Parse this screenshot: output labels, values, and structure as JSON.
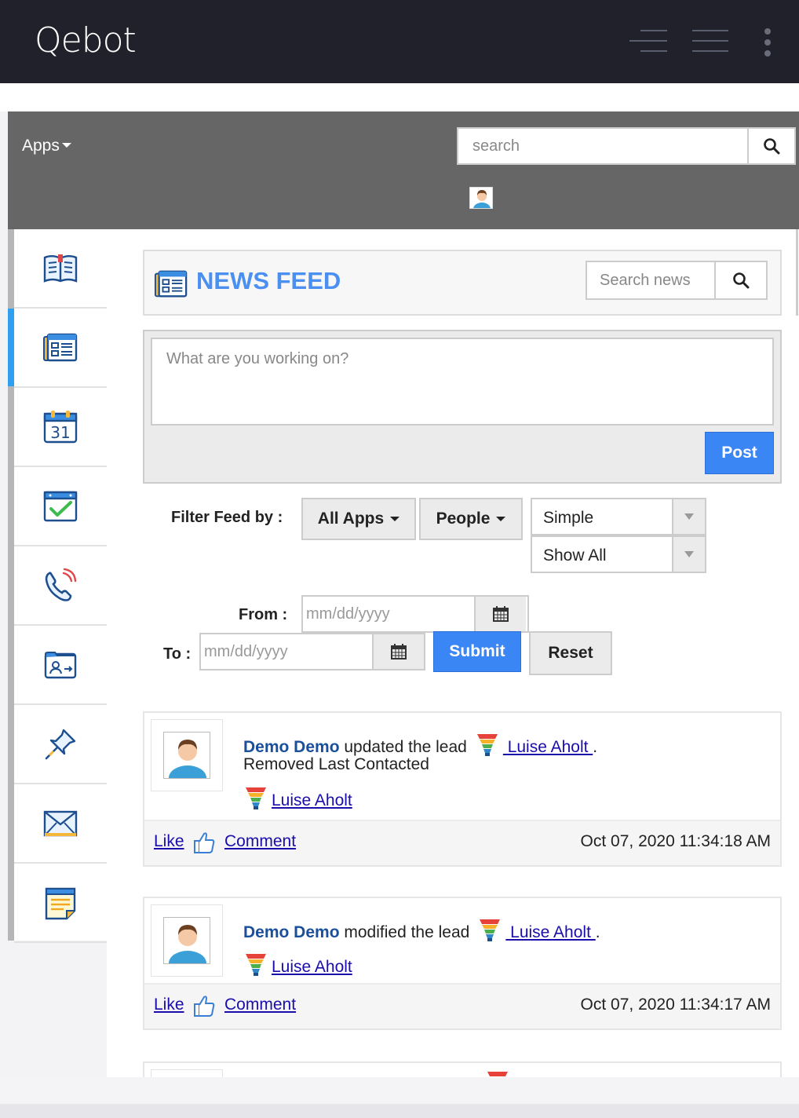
{
  "app": {
    "brand": "Qebot"
  },
  "appbar": {
    "apps_label": "Apps",
    "search_placeholder": "search"
  },
  "sidebar": {
    "items": [
      {
        "name": "sidebar-item-guide",
        "icon": "book-icon"
      },
      {
        "name": "sidebar-item-newsfeed",
        "icon": "newsfeed-icon",
        "active": true
      },
      {
        "name": "sidebar-item-calendar",
        "icon": "calendar-icon",
        "calendar_day": "31"
      },
      {
        "name": "sidebar-item-tasks",
        "icon": "task-check-icon"
      },
      {
        "name": "sidebar-item-calls",
        "icon": "phone-icon"
      },
      {
        "name": "sidebar-item-contacts",
        "icon": "contact-card-icon"
      },
      {
        "name": "sidebar-item-pins",
        "icon": "pushpin-icon"
      },
      {
        "name": "sidebar-item-mail",
        "icon": "envelope-icon"
      },
      {
        "name": "sidebar-item-notes",
        "icon": "notes-icon"
      }
    ]
  },
  "newsfeed": {
    "title": "NEWS FEED",
    "search_placeholder": "Search news",
    "post_placeholder": "What are you working on?",
    "post_label": "Post"
  },
  "filter": {
    "label": "Filter Feed by :",
    "all_apps": "All Apps",
    "people": "People",
    "view_select": "Simple",
    "scope_select": "Show All",
    "from_label": "From :",
    "to_label": "To :",
    "date_placeholder": "mm/dd/yyyy",
    "submit_label": "Submit",
    "reset_label": "Reset"
  },
  "feed": [
    {
      "user": "Demo Demo",
      "action": "updated the lead",
      "lead_link": " Luise Aholt ",
      "trailing": ".",
      "detail": "Removed Last Contacted",
      "lead_name": "Luise Aholt",
      "like": "Like",
      "comment": "Comment",
      "timestamp": "Oct 07, 2020 11:34:18 AM"
    },
    {
      "user": "Demo Demo",
      "action": "modified the lead",
      "lead_link": " Luise Aholt ",
      "trailing": ".",
      "lead_name": "Luise Aholt",
      "like": "Like",
      "comment": "Comment",
      "timestamp": "Oct 07, 2020 11:34:17 AM"
    }
  ],
  "colors": {
    "accent": "#3b86f5",
    "topbar": "#20212b",
    "appbar": "#666666",
    "title": "#4b8ff0"
  }
}
